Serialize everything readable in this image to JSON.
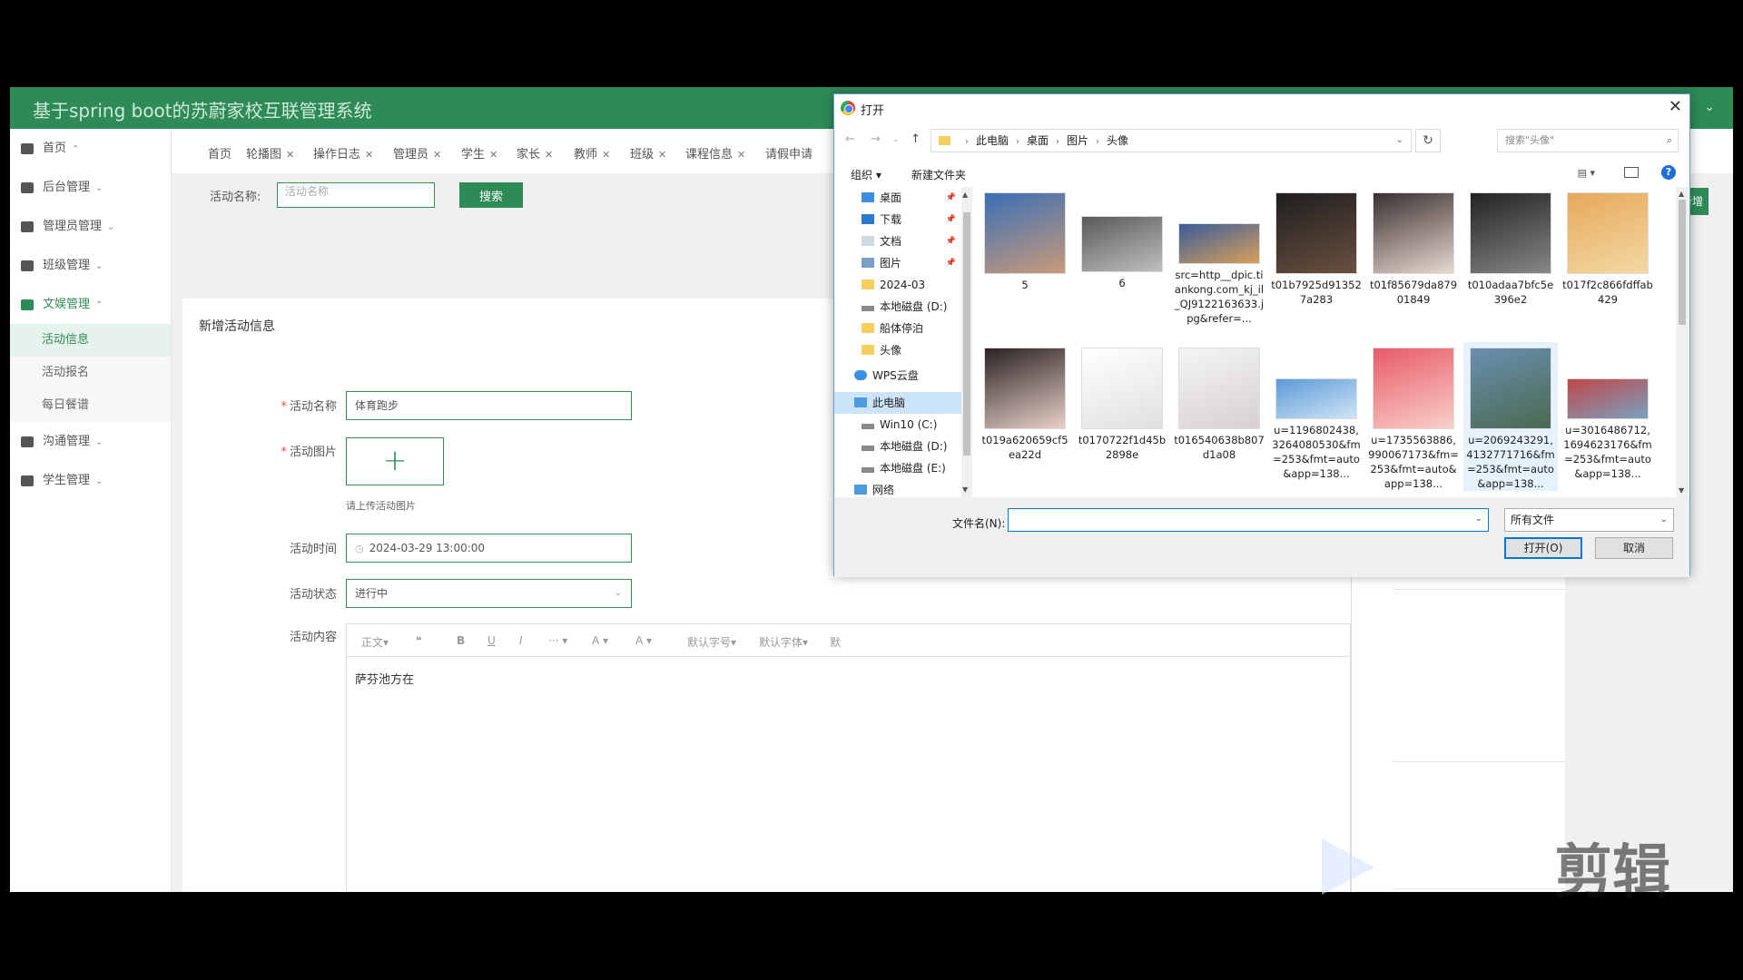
{
  "app": {
    "title": "基于spring boot的苏蔚家校互联管理系统"
  },
  "sidebar": {
    "items": [
      {
        "label": "首页",
        "caret": "⌃"
      },
      {
        "label": "后台管理",
        "caret": "⌄"
      },
      {
        "label": "管理员管理",
        "caret": "⌄"
      },
      {
        "label": "班级管理",
        "caret": "⌄"
      },
      {
        "label": "文娱管理",
        "caret": "⌃"
      },
      {
        "label": "沟通管理",
        "caret": "⌄"
      },
      {
        "label": "学生管理",
        "caret": "⌄"
      }
    ],
    "submenu": [
      "活动信息",
      "活动报名",
      "每日餐谱"
    ]
  },
  "tabs": [
    "首页",
    "轮播图",
    "操作日志",
    "管理员",
    "学生",
    "家长",
    "教师",
    "班级",
    "课程信息",
    "请假申请"
  ],
  "search": {
    "label": "活动名称:",
    "placeholder": "活动名称",
    "button": "搜索"
  },
  "right_button": "新增",
  "form": {
    "title": "新增活动信息",
    "name_label": "活动名称",
    "name_value": "体育跑步",
    "image_label": "活动图片",
    "upload_plus": "+",
    "upload_hint": "请上传活动图片",
    "time_label": "活动时间",
    "time_value": "2024-03-29 13:00:00",
    "status_label": "活动状态",
    "status_value": "进行中",
    "content_label": "活动内容",
    "toolbar": [
      "正文▾",
      "❝",
      "B",
      "U",
      "I",
      "··· ▾",
      "A ▾",
      "A ▾",
      "默认字号▾",
      "默认字体▾",
      "默"
    ],
    "content_value": "萨芬池方在"
  },
  "file_dialog": {
    "title": "打开",
    "breadcrumb": [
      "此电脑",
      "桌面",
      "图片",
      "头像"
    ],
    "search_placeholder": "搜索\"头像\"",
    "organize": "组织 ▾",
    "new_folder": "新建文件夹",
    "nav_tree": [
      {
        "label": "桌面",
        "pinned": true
      },
      {
        "label": "下载",
        "pinned": true
      },
      {
        "label": "文档",
        "pinned": true
      },
      {
        "label": "图片",
        "pinned": true
      },
      {
        "label": "2024-03",
        "pinned": false
      },
      {
        "label": "本地磁盘 (D:)",
        "pinned": false
      },
      {
        "label": "船体停泊",
        "pinned": false
      },
      {
        "label": "头像",
        "pinned": false
      },
      {
        "label": "WPS云盘",
        "pinned": false
      },
      {
        "label": "此电脑",
        "pinned": false
      },
      {
        "label": "Win10 (C:)",
        "pinned": false
      },
      {
        "label": "本地磁盘 (D:)",
        "pinned": false
      },
      {
        "label": "本地磁盘 (E:)",
        "pinned": false
      },
      {
        "label": "网络",
        "pinned": false
      }
    ],
    "files": [
      {
        "name": "5",
        "colors": [
          "#3a6fb5",
          "#c99a7a"
        ]
      },
      {
        "name": "6",
        "colors": [
          "#5a5a5a",
          "#bfbfbf"
        ]
      },
      {
        "name": "src=http__dpic.tiankong.com_kj_il_QJ9122163633.jpg&refer=...",
        "colors": [
          "#3a5c9a",
          "#d8a05a"
        ]
      },
      {
        "name": "t01b7925d913527a283",
        "colors": [
          "#1e1e1e",
          "#6a5040"
        ]
      },
      {
        "name": "t01f85679da87901849",
        "colors": [
          "#3a3030",
          "#e8d8d0"
        ]
      },
      {
        "name": "t010adaa7bfc5e396e2",
        "colors": [
          "#222222",
          "#888888"
        ]
      },
      {
        "name": "t017f2c866fdffab429",
        "colors": [
          "#e6a85a",
          "#f3d9a4"
        ]
      },
      {
        "name": "t019a620659cf5ea22d",
        "colors": [
          "#2a2222",
          "#e8d0c8"
        ]
      },
      {
        "name": "t0170722f1d45b2898e",
        "colors": [
          "#ffffff",
          "#e0e0e0"
        ]
      },
      {
        "name": "t016540638b807d1a08",
        "colors": [
          "#f4f4f4",
          "#d8d0d0"
        ]
      },
      {
        "name": "u=1196802438,3264080530&fm=253&fmt=auto&app=138...",
        "colors": [
          "#5c9ad8",
          "#cfe4f5"
        ]
      },
      {
        "name": "u=1735563886,990067173&fm=253&fmt=auto&app=138...",
        "colors": [
          "#e85a6a",
          "#f8d0c8"
        ]
      },
      {
        "name": "u=2069243291,4132771716&fm=253&fmt=auto&app=138...",
        "colors": [
          "#6a8fb0",
          "#4a6a50"
        ]
      },
      {
        "name": "u=3016486712,1694623176&fm=253&fmt=auto&app=138...",
        "colors": [
          "#c04848",
          "#7aa0c0"
        ]
      }
    ],
    "filename_label": "文件名(N):",
    "filename_value": "",
    "filetype": "所有文件",
    "open_button": "打开(O)",
    "cancel_button": "取消"
  },
  "watermark": "剪辑"
}
